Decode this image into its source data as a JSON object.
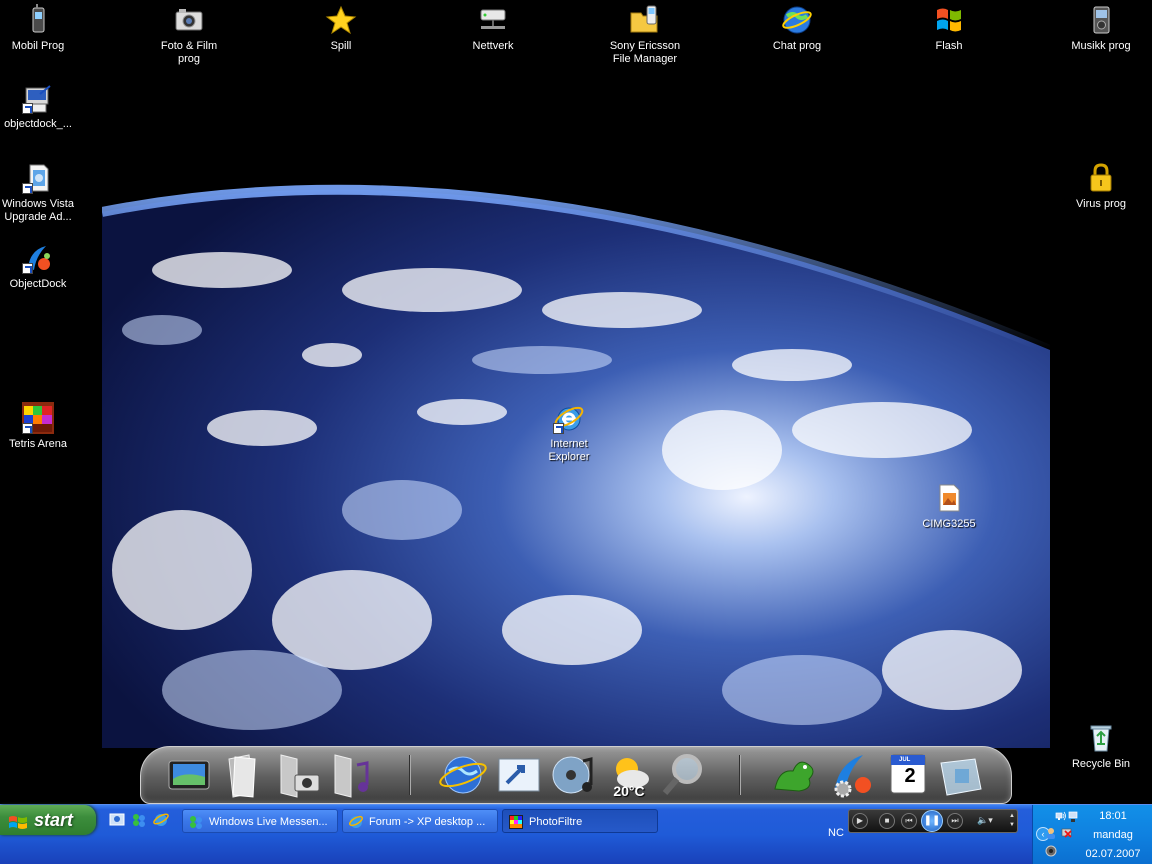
{
  "desktop": {
    "icons": [
      {
        "name": "mobil-prog",
        "label": "Mobil Prog"
      },
      {
        "name": "foto-film-prog",
        "label": "Foto & Film\nprog"
      },
      {
        "name": "spill",
        "label": "Spill"
      },
      {
        "name": "nettverk",
        "label": "Nettverk"
      },
      {
        "name": "sony-ericsson",
        "label": "Sony Ericsson\nFile Manager"
      },
      {
        "name": "chat-prog",
        "label": "Chat prog"
      },
      {
        "name": "flash",
        "label": "Flash"
      },
      {
        "name": "musikk-prog",
        "label": "Musikk prog"
      },
      {
        "name": "objectdock-installer",
        "label": "objectdock_..."
      },
      {
        "name": "windows-vista-upgrade",
        "label": "Windows Vista\nUpgrade Ad..."
      },
      {
        "name": "objectdock",
        "label": "ObjectDock"
      },
      {
        "name": "tetris-arena",
        "label": "Tetris Arena"
      },
      {
        "name": "virus-prog",
        "label": "Virus prog"
      },
      {
        "name": "internet-explorer",
        "label": "Internet\nExplorer"
      },
      {
        "name": "cimg3255",
        "label": "CIMG3255"
      },
      {
        "name": "recycle-bin",
        "label": "Recycle Bin"
      }
    ]
  },
  "dock": {
    "weather_temp": "20°C",
    "calendar_month": "JUL",
    "calendar_day": "2"
  },
  "taskbar": {
    "start_label": "start",
    "tasks": [
      {
        "label": "Windows Live Messen..."
      },
      {
        "label": "Forum -> XP desktop ..."
      },
      {
        "label": "PhotoFiltre"
      }
    ],
    "nc_label": "NC",
    "clock": {
      "time": "18:01",
      "day": "mandag",
      "date": "02.07.2007"
    }
  },
  "colors": {
    "taskbar_blue": "#245edb",
    "start_green": "#3c8d3c",
    "tray_blue": "#0f81e0"
  }
}
